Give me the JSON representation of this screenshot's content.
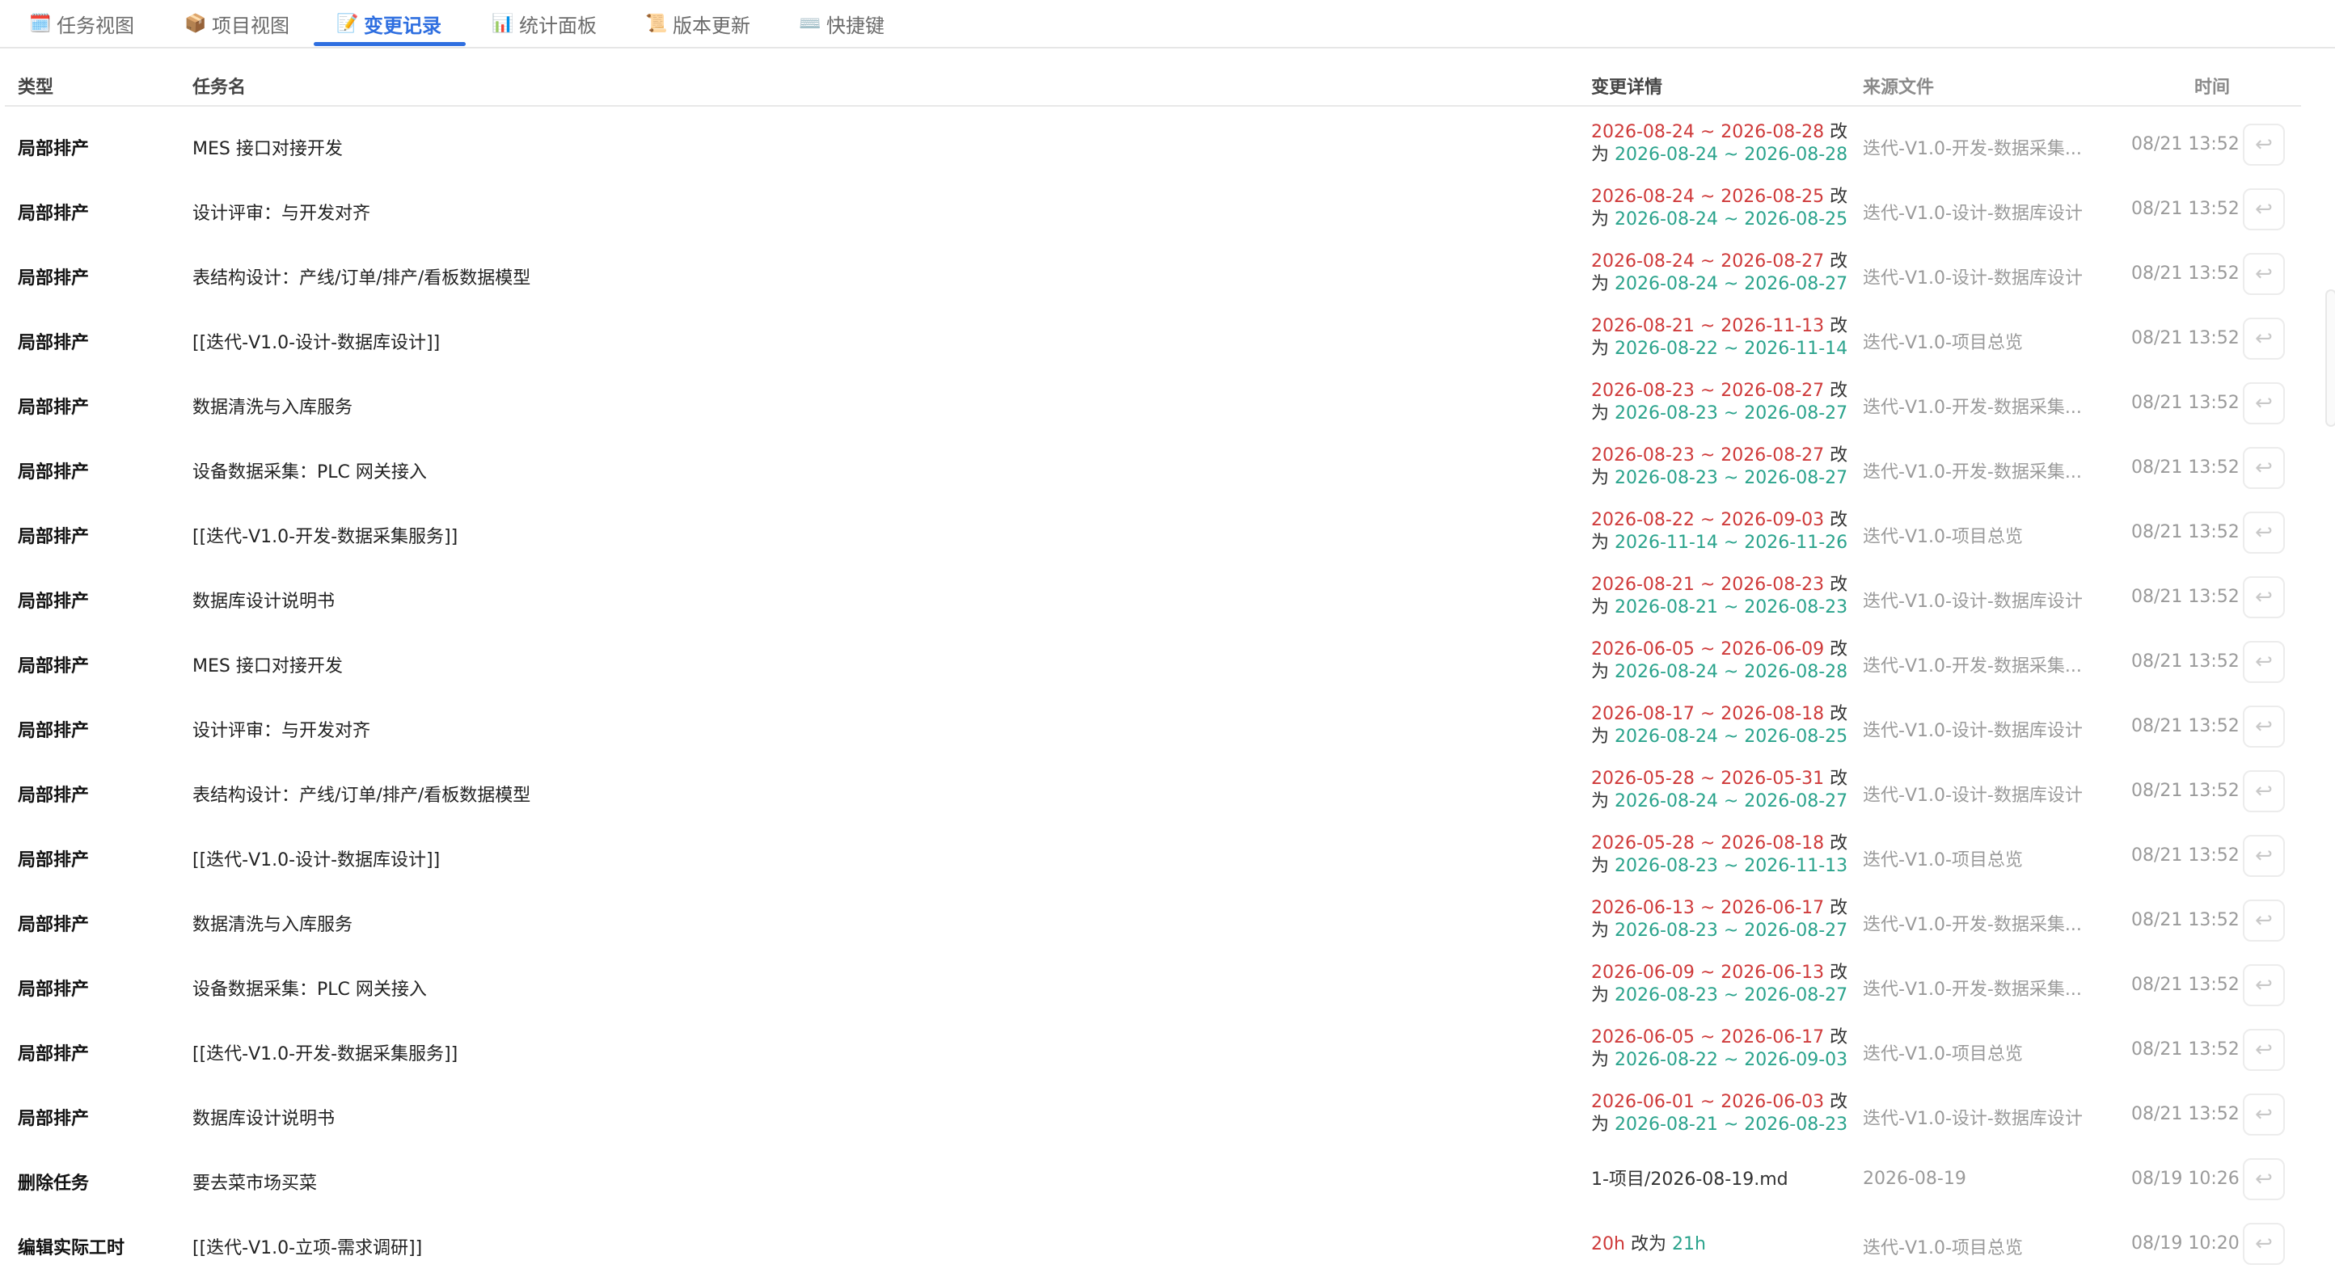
{
  "tabs": [
    {
      "icon": "🗓️",
      "label": "任务视图"
    },
    {
      "icon": "📦",
      "label": "项目视图"
    },
    {
      "icon": "📝",
      "label": "变更记录"
    },
    {
      "icon": "📊",
      "label": "统计面板"
    },
    {
      "icon": "📜",
      "label": "版本更新"
    },
    {
      "icon": "⌨️",
      "label": "快捷键"
    }
  ],
  "active_tab": "变更记录",
  "colors": {
    "accent": "#2f6fe0",
    "old_value": "#cf3a3a",
    "new_value": "#2aa38c"
  },
  "headers": {
    "type": "类型",
    "task": "任务名",
    "detail": "变更详情",
    "source": "来源文件",
    "time": "时间"
  },
  "connector": "改为",
  "undo_icon": "undo-arrow-icon",
  "rows": [
    {
      "type": "局部排产",
      "task": "MES 接口对接开发",
      "old": "2026-08-24 ~ 2026-08-28",
      "conn_a": "改",
      "conn_b": "为",
      "new": "2026-08-24 ~ 2026-08-28",
      "source": "迭代-V1.0-开发-数据采集...",
      "time": "08/21 13:52"
    },
    {
      "type": "局部排产",
      "task": "设计评审：与开发对齐",
      "old": "2026-08-24 ~ 2026-08-25",
      "conn_a": "改",
      "conn_b": "为",
      "new": "2026-08-24 ~ 2026-08-25",
      "source": "迭代-V1.0-设计-数据库设计",
      "time": "08/21 13:52"
    },
    {
      "type": "局部排产",
      "task": "表结构设计：产线/订单/排产/看板数据模型",
      "old": "2026-08-24 ~ 2026-08-27",
      "conn_a": "改",
      "conn_b": "为",
      "new": "2026-08-24 ~ 2026-08-27",
      "source": "迭代-V1.0-设计-数据库设计",
      "time": "08/21 13:52"
    },
    {
      "type": "局部排产",
      "task": "[[迭代-V1.0-设计-数据库设计]]",
      "old": "2026-08-21 ~ 2026-11-13",
      "conn_a": "改",
      "conn_b": "为",
      "new": "2026-08-22 ~ 2026-11-14",
      "source": "迭代-V1.0-项目总览",
      "time": "08/21 13:52"
    },
    {
      "type": "局部排产",
      "task": "数据清洗与入库服务",
      "old": "2026-08-23 ~ 2026-08-27",
      "conn_a": "改",
      "conn_b": "为",
      "new": "2026-08-23 ~ 2026-08-27",
      "source": "迭代-V1.0-开发-数据采集...",
      "time": "08/21 13:52"
    },
    {
      "type": "局部排产",
      "task": "设备数据采集：PLC 网关接入",
      "old": "2026-08-23 ~ 2026-08-27",
      "conn_a": "改",
      "conn_b": "为",
      "new": "2026-08-23 ~ 2026-08-27",
      "source": "迭代-V1.0-开发-数据采集...",
      "time": "08/21 13:52"
    },
    {
      "type": "局部排产",
      "task": "[[迭代-V1.0-开发-数据采集服务]]",
      "old": "2026-08-22 ~ 2026-09-03",
      "conn_a": "改",
      "conn_b": "为",
      "new": "2026-11-14 ~ 2026-11-26",
      "source": "迭代-V1.0-项目总览",
      "time": "08/21 13:52"
    },
    {
      "type": "局部排产",
      "task": "数据库设计说明书",
      "old": "2026-08-21 ~ 2026-08-23",
      "conn_a": "改",
      "conn_b": "为",
      "new": "2026-08-21 ~ 2026-08-23",
      "source": "迭代-V1.0-设计-数据库设计",
      "time": "08/21 13:52"
    },
    {
      "type": "局部排产",
      "task": "MES 接口对接开发",
      "old": "2026-06-05 ~ 2026-06-09",
      "conn_a": "改",
      "conn_b": "为",
      "new": "2026-08-24 ~ 2026-08-28",
      "source": "迭代-V1.0-开发-数据采集...",
      "time": "08/21 13:52"
    },
    {
      "type": "局部排产",
      "task": "设计评审：与开发对齐",
      "old": "2026-08-17 ~ 2026-08-18",
      "conn_a": "改",
      "conn_b": "为",
      "new": "2026-08-24 ~ 2026-08-25",
      "source": "迭代-V1.0-设计-数据库设计",
      "time": "08/21 13:52"
    },
    {
      "type": "局部排产",
      "task": "表结构设计：产线/订单/排产/看板数据模型",
      "old": "2026-05-28 ~ 2026-05-31",
      "conn_a": "改",
      "conn_b": "为",
      "new": "2026-08-24 ~ 2026-08-27",
      "source": "迭代-V1.0-设计-数据库设计",
      "time": "08/21 13:52"
    },
    {
      "type": "局部排产",
      "task": "[[迭代-V1.0-设计-数据库设计]]",
      "old": "2026-05-28 ~ 2026-08-18",
      "conn_a": "改",
      "conn_b": "为",
      "new": "2026-08-23 ~ 2026-11-13",
      "source": "迭代-V1.0-项目总览",
      "time": "08/21 13:52"
    },
    {
      "type": "局部排产",
      "task": "数据清洗与入库服务",
      "old": "2026-06-13 ~ 2026-06-17",
      "conn_a": "改",
      "conn_b": "为",
      "new": "2026-08-23 ~ 2026-08-27",
      "source": "迭代-V1.0-开发-数据采集...",
      "time": "08/21 13:52"
    },
    {
      "type": "局部排产",
      "task": "设备数据采集：PLC 网关接入",
      "old": "2026-06-09 ~ 2026-06-13",
      "conn_a": "改",
      "conn_b": "为",
      "new": "2026-08-23 ~ 2026-08-27",
      "source": "迭代-V1.0-开发-数据采集...",
      "time": "08/21 13:52"
    },
    {
      "type": "局部排产",
      "task": "[[迭代-V1.0-开发-数据采集服务]]",
      "old": "2026-06-05 ~ 2026-06-17",
      "conn_a": "改",
      "conn_b": "为",
      "new": "2026-08-22 ~ 2026-09-03",
      "source": "迭代-V1.0-项目总览",
      "time": "08/21 13:52"
    },
    {
      "type": "局部排产",
      "task": "数据库设计说明书",
      "old": "2026-06-01 ~ 2026-06-03",
      "conn_a": "改",
      "conn_b": "为",
      "new": "2026-08-21 ~ 2026-08-23",
      "source": "迭代-V1.0-设计-数据库设计",
      "time": "08/21 13:52"
    },
    {
      "type": "删除任务",
      "task": "要去菜市场买菜",
      "plain": "1-项目/2026-08-19.md",
      "source": "2026-08-19",
      "time": "08/19 10:26"
    },
    {
      "type": "编辑实际工时",
      "task": "[[迭代-V1.0-立项-需求调研]]",
      "old": "20h",
      "conn_inline": "改为",
      "new": "21h",
      "source": "迭代-V1.0-项目总览",
      "time": "08/19 10:20"
    }
  ]
}
